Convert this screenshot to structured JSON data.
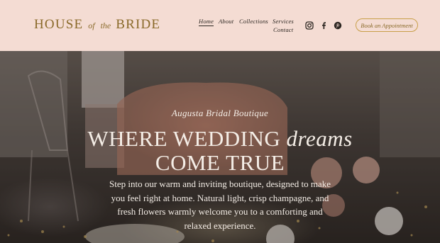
{
  "brand": {
    "logo_part1": "HOUSE",
    "logo_of": "of",
    "logo_the": "the",
    "logo_part2": "BRIDE"
  },
  "nav": {
    "home": "Home",
    "about": "About",
    "collections": "Collections",
    "services": "Services",
    "contact": "Contact"
  },
  "social": [
    "instagram-icon",
    "facebook-icon",
    "pinterest-icon"
  ],
  "cta_label": "Book an Appointment",
  "hero": {
    "tagline": "Augusta Bridal Boutique",
    "headline_part1": "WHERE WEDDING",
    "headline_em": "dreams",
    "headline_part2": "COME TRUE",
    "body": "Step into our warm and inviting boutique, designed to make you feel right at home. Natural light, crisp champagne, and fresh flowers warmly welcome you to a comforting and relaxed experience."
  },
  "colors": {
    "header_bg": "#f4dcd3",
    "gold": "#c9a04a",
    "brand_text": "#8a6a2a"
  }
}
